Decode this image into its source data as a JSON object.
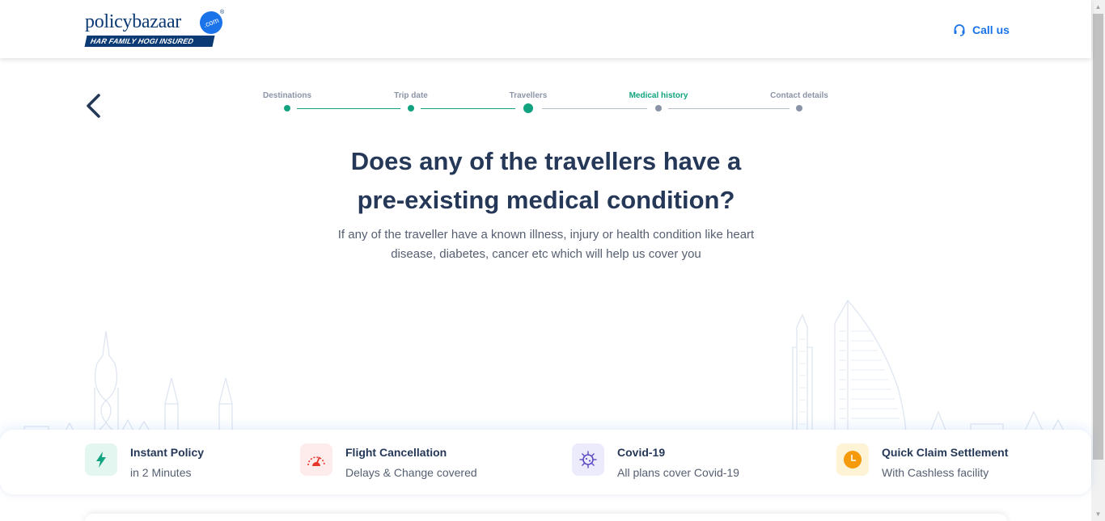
{
  "header": {
    "logo_word": "policybazaar",
    "logo_com": ".com",
    "logo_tm": "®",
    "logo_tagline": "HAR FAMILY HOGI INSURED",
    "call_us_label": "Call us"
  },
  "stepper": {
    "steps": [
      {
        "label": "Destinations",
        "state": "done"
      },
      {
        "label": "Trip date",
        "state": "done"
      },
      {
        "label": "Travellers",
        "state": "done"
      },
      {
        "label": "Medical history",
        "state": "active"
      },
      {
        "label": "Contact details",
        "state": "pending"
      }
    ]
  },
  "question": {
    "line1": "Does any of the travellers have a",
    "line2": "pre-existing medical condition?",
    "description_line1": "If any of the traveller have a known illness, injury or health condition like heart",
    "description_line2": "disease, diabetes, cancer etc which will help us cover you"
  },
  "features": [
    {
      "title": "Instant Policy",
      "subtitle": "in 2 Minutes",
      "icon": "lightning-icon",
      "color": "#11a37f",
      "bg": "#e3f6ef"
    },
    {
      "title": "Flight Cancellation",
      "subtitle": "Delays & Change covered",
      "icon": "gauge-icon",
      "color": "#e5362b",
      "bg": "#fdeceb"
    },
    {
      "title": "Covid-19",
      "subtitle": "All plans cover Covid-19",
      "icon": "virus-icon",
      "color": "#5c4bc4",
      "bg": "#ecebfb"
    },
    {
      "title": "Quick Claim Settlement",
      "subtitle": "With Cashless facility",
      "icon": "clock-icon",
      "color": "#f59a0b",
      "bg": "#fff3d6"
    }
  ],
  "colors": {
    "brand": "#0b3a74",
    "accent": "#1a73e8",
    "success": "#11a37f",
    "heading": "#253858"
  }
}
